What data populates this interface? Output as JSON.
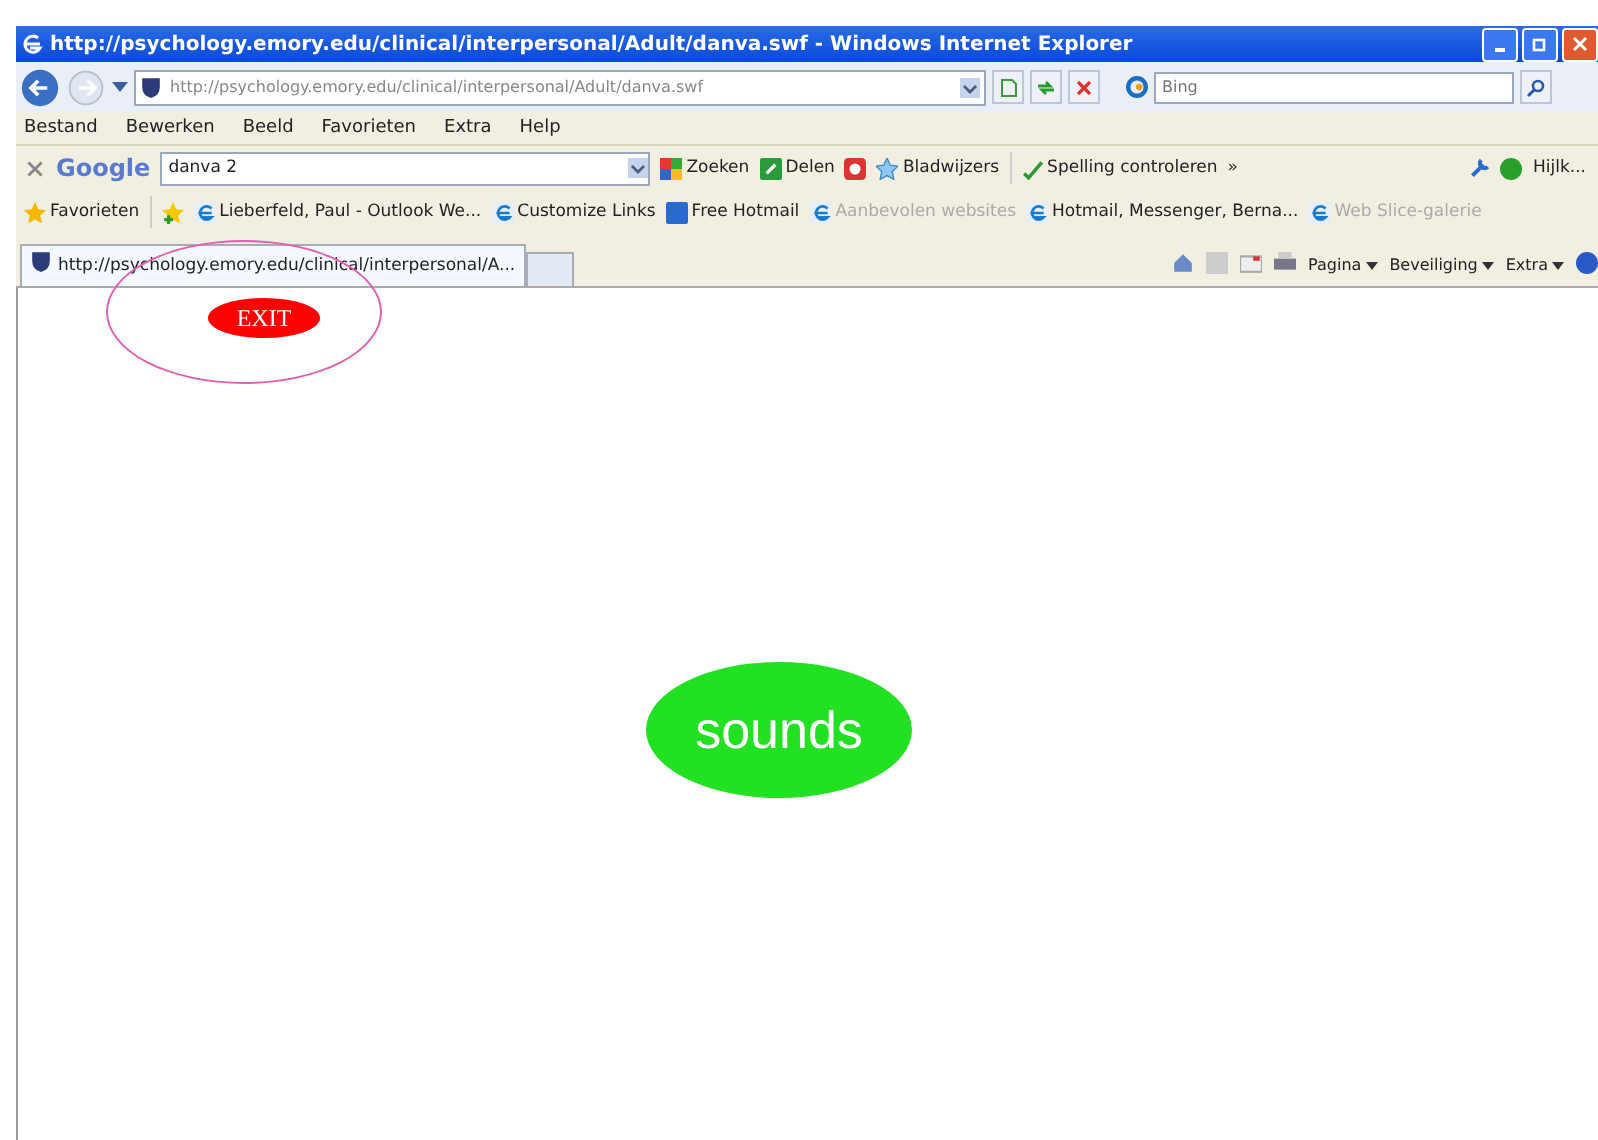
{
  "window": {
    "title": "http://psychology.emory.edu/clinical/interpersonal/Adult/danva.swf - Windows Internet Explorer"
  },
  "address_bar": {
    "url": "http://psychology.emory.edu/clinical/interpersonal/Adult/danva.swf",
    "search_placeholder": "Bing"
  },
  "menu": [
    "Bestand",
    "Bewerken",
    "Beeld",
    "Favorieten",
    "Extra",
    "Help"
  ],
  "google_toolbar": {
    "logo": "Google",
    "query": "danva 2",
    "items": [
      {
        "kind": "search",
        "label": "Zoeken"
      },
      {
        "kind": "share",
        "label": "Delen"
      },
      {
        "kind": "bookmarks",
        "label": "Bladwijzers"
      },
      {
        "kind": "spelling",
        "label": "Spelling controleren"
      },
      {
        "kind": "more",
        "label": "»"
      }
    ],
    "account": "Hijlk..."
  },
  "favorites_bar": {
    "label": "Favorieten",
    "links": [
      {
        "label": "Lieberfeld, Paul - Outlook We...",
        "dimmed": false
      },
      {
        "label": "Customize Links",
        "dimmed": false
      },
      {
        "label": "Free Hotmail",
        "dimmed": false
      },
      {
        "label": "Aanbevolen websites",
        "dimmed": true
      },
      {
        "label": "Hotmail, Messenger, Berna...",
        "dimmed": false
      },
      {
        "label": "Web Slice-galerie",
        "dimmed": true
      }
    ]
  },
  "tabs": [
    {
      "label": "http://psychology.emory.edu/clinical/interpersonal/A...",
      "selected": true
    }
  ],
  "command_bar": [
    "Pagina",
    "Beveiliging",
    "Extra"
  ],
  "page": {
    "exit_button": "EXIT",
    "sounds_button": "sounds",
    "highlight_circle": true
  }
}
